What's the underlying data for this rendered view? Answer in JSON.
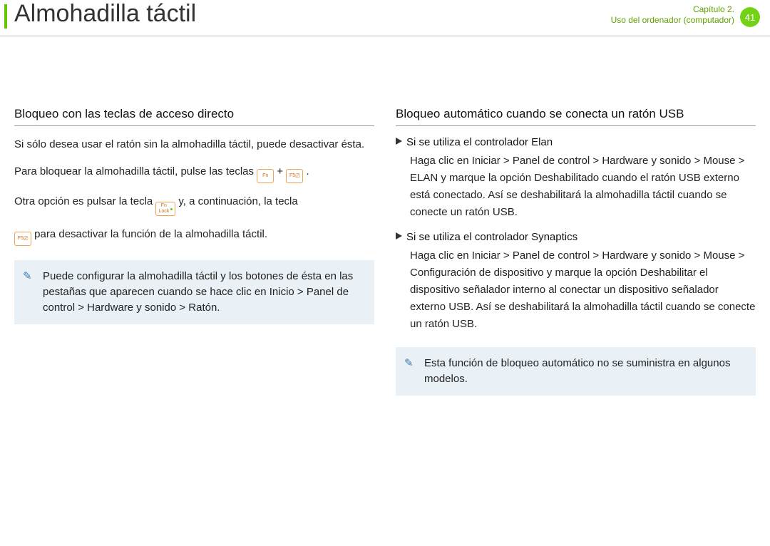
{
  "header": {
    "title": "Almohadilla táctil",
    "chapter_line1": "Capítulo 2.",
    "chapter_line2": "Uso del ordenador (computador)",
    "page_number": "41"
  },
  "left": {
    "section_title": "Bloqueo con las teclas de acceso directo",
    "p1": "Si sólo desea usar el ratón sin la almohadilla táctil, puede desactivar ésta.",
    "p2_a": "Para bloquear la almohadilla táctil, pulse las teclas ",
    "p2_plus": " + ",
    "p2_b": " .",
    "p3_a": "Otra opción es pulsar la tecla ",
    "p3_b": " y, a continuación, la tecla",
    "p4_a": "",
    "p4_b": " para desactivar la función de la almohadilla táctil.",
    "note": "Puede configurar la almohadilla táctil y los botones de ésta en las pestañas que aparecen cuando se hace clic en Inicio > Panel de control > Hardware y sonido > Ratón.",
    "key_fn": "Fn",
    "key_f5": "F5",
    "key_fn_lock": "Fn\nLock"
  },
  "right": {
    "section_title": "Bloqueo automático cuando se conecta un ratón USB",
    "sub1": "Si se utiliza el controlador Elan",
    "p1": "Haga clic en Iniciar > Panel de control > Hardware y sonido > Mouse > ELAN y marque la opción Deshabilitado cuando el ratón USB externo está conectado. Así se deshabilitará la almohadilla táctil cuando se conecte un ratón USB.",
    "sub2": "Si se utiliza el controlador Synaptics",
    "p2": "Haga clic en Iniciar > Panel de control > Hardware y sonido > Mouse > Configuración de dispositivo y marque la opción Deshabilitar el dispositivo señalador interno al conectar un dispositivo señalador externo USB. Así se deshabilitará la almohadilla táctil cuando se conecte un ratón USB.",
    "note": "Esta función de bloqueo automático no se suministra en algunos modelos."
  }
}
